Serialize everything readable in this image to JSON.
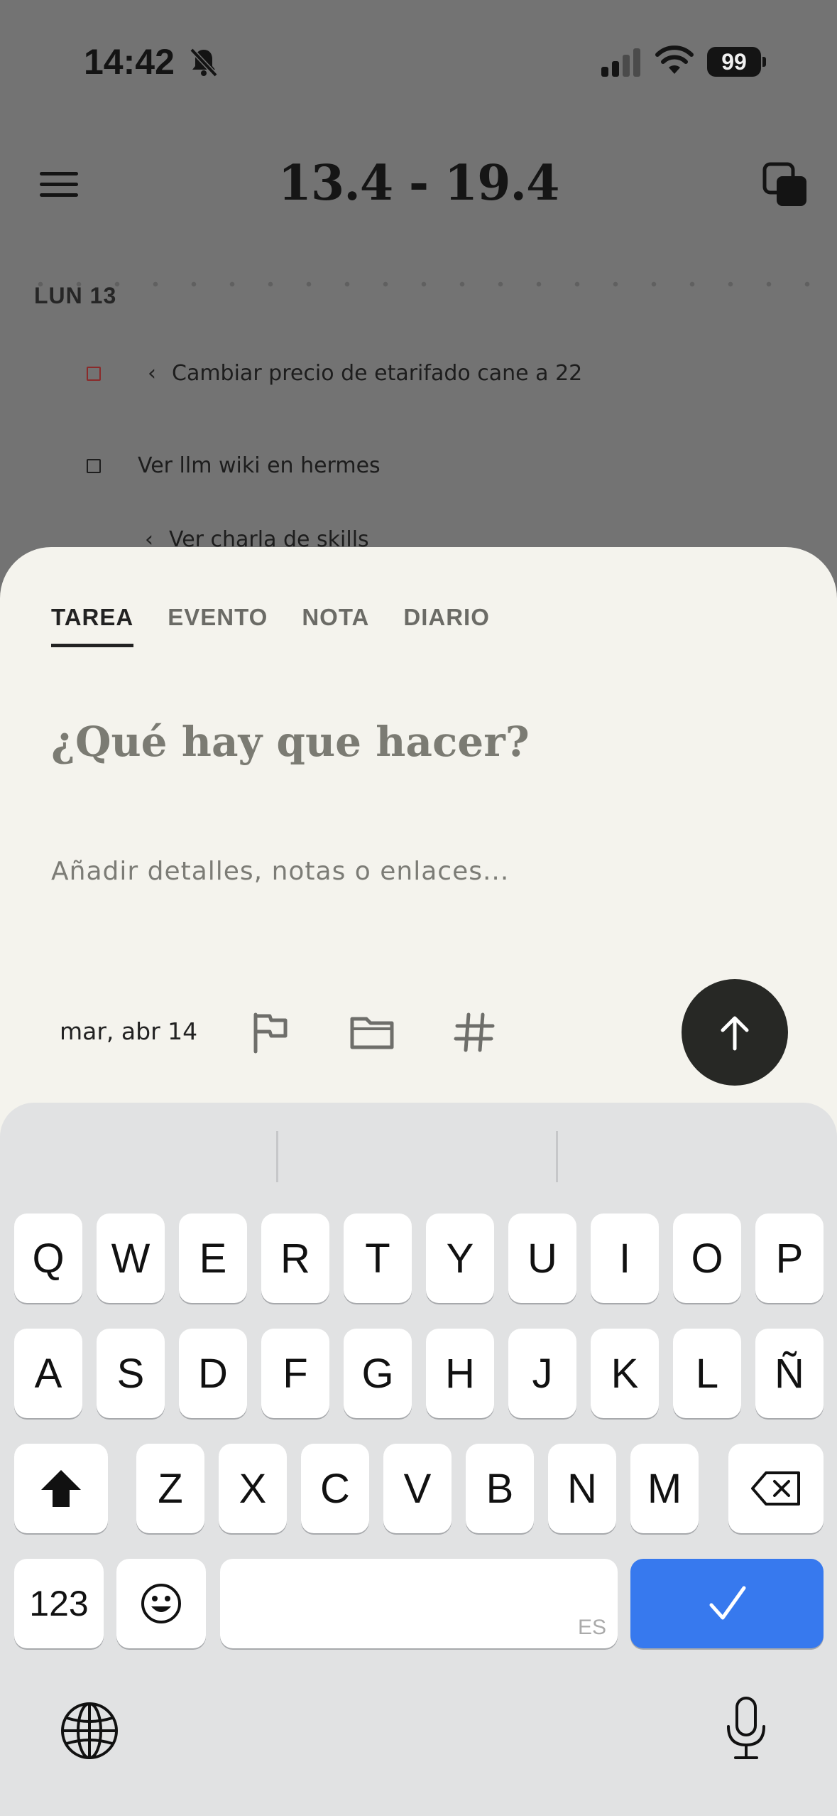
{
  "status_bar": {
    "time": "14:42",
    "battery": "99"
  },
  "header": {
    "title": "13.4 - 19.4"
  },
  "day": {
    "label": "LUN 13",
    "tasks": [
      {
        "text": "Cambiar precio de etarifado cane a 22"
      },
      {
        "text": "Ver llm wiki en hermes"
      },
      {
        "text": "Ver charla de skills"
      }
    ]
  },
  "sheet": {
    "tabs": [
      "TAREA",
      "EVENTO",
      "NOTA",
      "DIARIO"
    ],
    "title_placeholder": "¿Qué hay que hacer?",
    "details_placeholder": "Añadir detalles, notas o enlaces...",
    "date": "mar, abr 14"
  },
  "keyboard": {
    "row1": [
      "Q",
      "W",
      "E",
      "R",
      "T",
      "Y",
      "U",
      "I",
      "O",
      "P"
    ],
    "row2": [
      "A",
      "S",
      "D",
      "F",
      "G",
      "H",
      "J",
      "K",
      "L",
      "Ñ"
    ],
    "row3": [
      "Z",
      "X",
      "C",
      "V",
      "B",
      "N",
      "M"
    ],
    "numbers_label": "123",
    "space_lang": "ES"
  },
  "colors": {
    "accent": "#3779ee",
    "sheet": "#f4f3ed",
    "send": "#272825"
  }
}
